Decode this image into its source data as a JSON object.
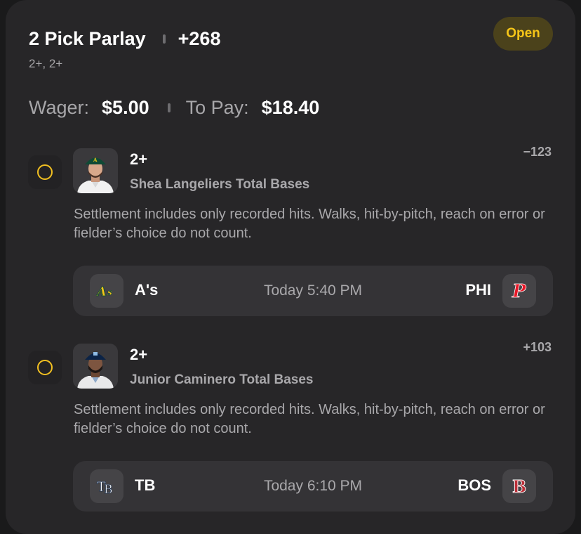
{
  "header": {
    "title": "2 Pick Parlay",
    "odds": "+268",
    "subtitle": "2+, 2+",
    "status": "Open"
  },
  "wager": {
    "wager_label": "Wager:",
    "wager_value": "$5.00",
    "pay_label": "To Pay:",
    "pay_value": "$18.40"
  },
  "picks": [
    {
      "line": "2+",
      "market": "Shea Langeliers Total Bases",
      "odds": "−123",
      "description": "Settlement includes only recorded hits. Walks, hit-by-pitch, reach on error or fielder’s choice do not count.",
      "game": {
        "away": "A's",
        "home": "PHI",
        "time": "Today 5:40 PM"
      }
    },
    {
      "line": "2+",
      "market": "Junior Caminero Total Bases",
      "odds": "+103",
      "description": "Settlement includes only recorded hits. Walks, hit-by-pitch, reach on error or fielder’s choice do not count.",
      "game": {
        "away": "TB",
        "home": "BOS",
        "time": "Today 6:10 PM"
      }
    }
  ],
  "icons": {
    "radio": "radio-unselected-icon",
    "away_logo_1": "athletics-logo-icon",
    "home_logo_1": "phillies-logo-icon",
    "away_logo_2": "rays-logo-icon",
    "home_logo_2": "red-sox-logo-icon"
  },
  "colors": {
    "accent": "#f5c518",
    "badge_bg": "#4b421b",
    "card_bg": "#272628"
  }
}
